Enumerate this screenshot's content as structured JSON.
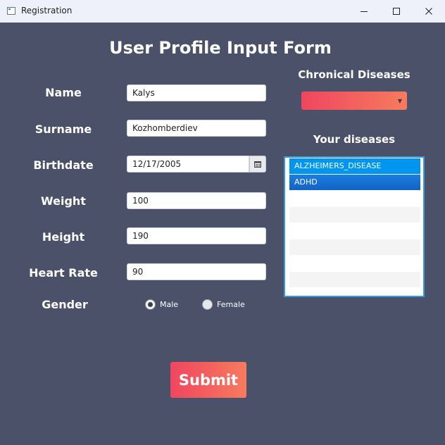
{
  "window": {
    "title": "Registration"
  },
  "form": {
    "title": "User Profile Input Form",
    "fields": {
      "name": {
        "label": "Name",
        "value": "Kalys"
      },
      "surname": {
        "label": "Surname",
        "value": "Kozhomberdiev"
      },
      "birthdate": {
        "label": "Birthdate",
        "value": "12/17/2005"
      },
      "weight": {
        "label": "Weight",
        "value": "100"
      },
      "height": {
        "label": "Height",
        "value": "190"
      },
      "heart_rate": {
        "label": "Heart Rate",
        "value": "90"
      }
    },
    "gender": {
      "label": "Gender",
      "options": [
        {
          "label": "Male",
          "selected": true
        },
        {
          "label": "Female",
          "selected": false
        }
      ]
    },
    "submit_label": "Submit"
  },
  "diseases": {
    "chronic_title": "Chronical Diseases",
    "dropdown_value": "",
    "your_title": "Your diseases",
    "list": [
      "ALZHEIMERS_DISEASE",
      "ADHD"
    ]
  },
  "colors": {
    "background": "#4a5168",
    "accent_start": "#f0465f",
    "accent_end": "#f67b5e",
    "selection": "#0096f0"
  }
}
